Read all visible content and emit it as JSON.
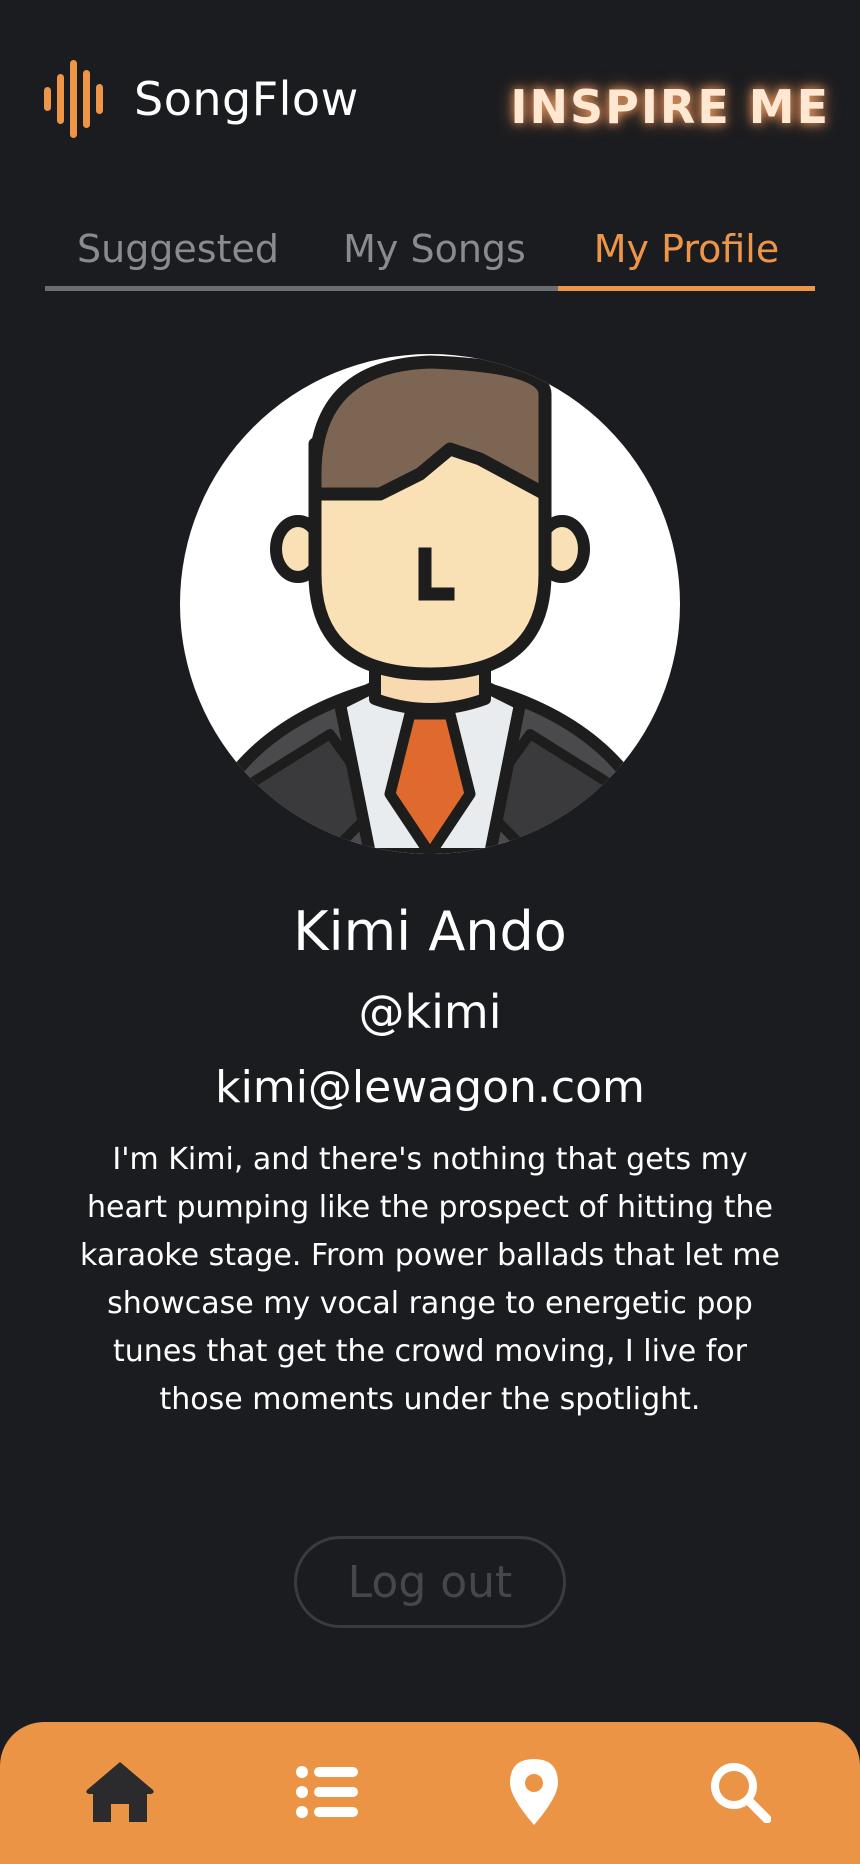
{
  "app": {
    "name": "SongFlow",
    "inspire_label": "INSPIRE ME"
  },
  "tabs": [
    {
      "label": "Suggested",
      "active": false
    },
    {
      "label": "My Songs",
      "active": false
    },
    {
      "label": "My Profile",
      "active": true
    }
  ],
  "profile": {
    "name": "Kimi Ando",
    "handle": "@kimi",
    "email": "kimi@lewagon.com",
    "bio": "I'm Kimi, and there's nothing that gets my heart pumping like the prospect of hitting the karaoke stage. From power ballads that let me showcase my vocal range to energetic pop tunes that get the crowd moving, I live for those moments under the spotlight."
  },
  "logout_label": "Log out",
  "bottom_nav": [
    {
      "icon": "home-icon"
    },
    {
      "icon": "list-icon"
    },
    {
      "icon": "location-pin-icon"
    },
    {
      "icon": "search-icon"
    }
  ],
  "colors": {
    "background": "#1b1c20",
    "accent": "#ee9548",
    "nav_background": "#ec9445",
    "tab_inactive": "#8a8b8f"
  }
}
